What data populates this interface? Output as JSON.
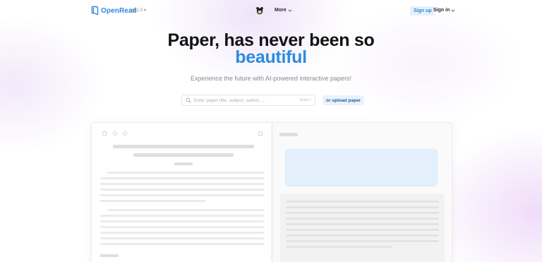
{
  "header": {
    "brand": "OpenRead",
    "version": "V1.1.0",
    "more_label": "More",
    "signup_label": "Sign up",
    "signin_label": "Sign in"
  },
  "hero": {
    "title_line1": "Paper, has never been so",
    "title_line2": "beautiful",
    "subtitle": "Experience the future with AI-powered interactive papers!"
  },
  "search": {
    "placeholder": "Enter paper title, subject, author, ...",
    "value": "",
    "hint": "Enter↵",
    "upload_label": "or upload paper"
  },
  "icons": {
    "logo": "openread-logo-icon",
    "mascot": "mascot-icon",
    "search": "search-icon",
    "chevron": "chevron-down-icon"
  },
  "colors": {
    "brand_blue": "#2f86d6",
    "accent_blue": "#2c8be0",
    "signup_bg": "#e5f0fb",
    "card_blue": "#e4f0fc"
  }
}
